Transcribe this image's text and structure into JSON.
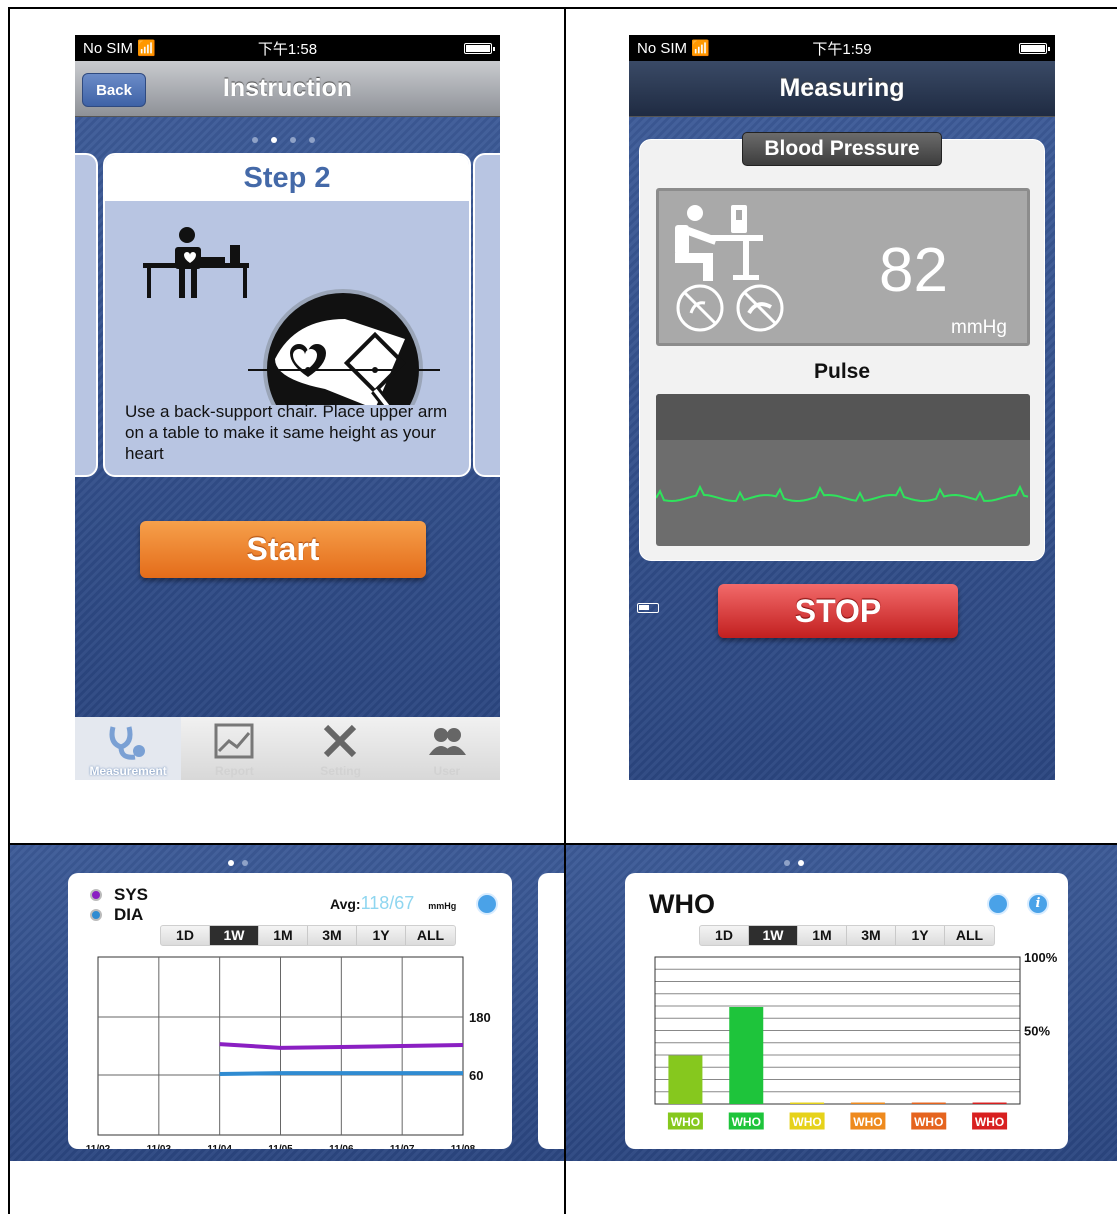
{
  "colors": {
    "sys": "#8a1fc2",
    "dia": "#2f8bd1",
    "who": [
      "#86c81e",
      "#1ec43b",
      "#e6d21a",
      "#ee8a1e",
      "#e5641f",
      "#d82020"
    ]
  },
  "instruction": {
    "status": {
      "carrier": "No SIM",
      "time": "下午1:58"
    },
    "nav": {
      "back_label": "Back",
      "title": "Instruction"
    },
    "page_dots": 4,
    "active_dot": 1,
    "step_title": "Step 2",
    "description": "Use a back-support chair. Place upper arm on a table to make it same height as your heart",
    "start_label": "Start",
    "tabs": [
      {
        "label": "Measurement",
        "icon": "stethoscope-icon",
        "active": true
      },
      {
        "label": "Report",
        "icon": "chart-icon",
        "active": false
      },
      {
        "label": "Setting",
        "icon": "tools-icon",
        "active": false
      },
      {
        "label": "User",
        "icon": "users-icon",
        "active": false
      }
    ]
  },
  "measuring": {
    "status": {
      "carrier": "No SIM",
      "time": "下午1:59"
    },
    "nav": {
      "title": "Measuring"
    },
    "badge": "Blood Pressure",
    "value": "82",
    "unit": "mmHg",
    "pulse_label": "Pulse",
    "stop_label": "STOP"
  },
  "trend_card": {
    "legend": [
      "SYS",
      "DIA"
    ],
    "avg_label": "Avg:",
    "avg_value": "118/67",
    "avg_unit": "mmHg",
    "ranges": [
      "1D",
      "1W",
      "1M",
      "3M",
      "1Y",
      "ALL"
    ],
    "active_range": "1W",
    "chart_data": {
      "type": "line",
      "x": [
        "11/02",
        "11/03",
        "11/04",
        "11/05",
        "11/06",
        "11/07",
        "11/08"
      ],
      "y_ticks": [
        180,
        60
      ],
      "series": [
        {
          "name": "SYS",
          "values": [
            null,
            null,
            124,
            116,
            118,
            120,
            122
          ]
        },
        {
          "name": "DIA",
          "values": [
            null,
            null,
            62,
            64,
            64,
            64,
            64
          ]
        }
      ],
      "title": "",
      "xlabel": "",
      "ylabel": "",
      "grid": true
    }
  },
  "who_card": {
    "title": "WHO",
    "ranges": [
      "1D",
      "1W",
      "1M",
      "3M",
      "1Y",
      "ALL"
    ],
    "active_range": "1W",
    "chart_data": {
      "type": "bar",
      "categories": [
        "WHO",
        "WHO",
        "WHO",
        "WHO",
        "WHO",
        "WHO"
      ],
      "values": [
        33,
        66,
        1,
        1,
        1,
        1
      ],
      "y_ticks": [
        "100%",
        "50%"
      ],
      "title": "",
      "xlabel": "",
      "ylabel": "",
      "ylim": [
        0,
        100
      ],
      "grid": true
    }
  }
}
